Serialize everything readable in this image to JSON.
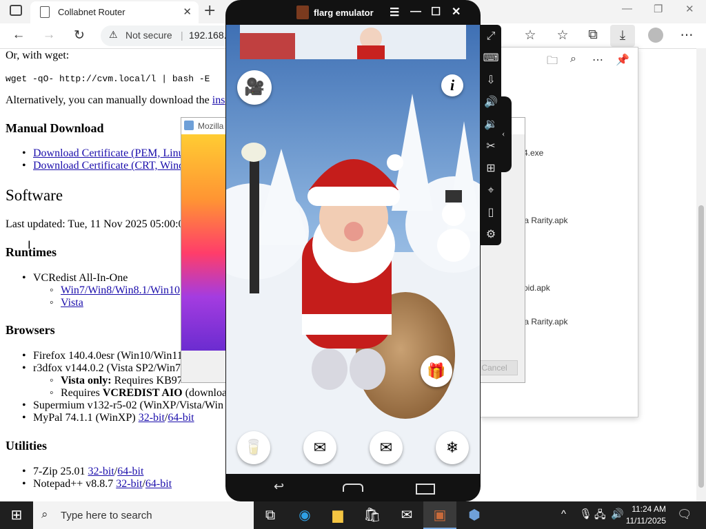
{
  "browser": {
    "tab_title": "Collabnet Router",
    "address_security": "Not secure",
    "address_text": "192.168."
  },
  "page": {
    "wget_intro": "Or, with wget:",
    "wget_cmd": "wget -qO- http://cvm.local/l | bash -E",
    "alt_text": "Alternatively, you can manually download the",
    "alt_link": "ins",
    "manual_download_heading": "Manual Download",
    "cert_pem": "Download Certificate (PEM, Linu",
    "cert_crt": "Download Certificate (CRT, Wind",
    "software_heading": "Software",
    "last_updated": "Last updated: Tue, 11 Nov 2025 05:00:0",
    "runtimes_heading": "Runtimes",
    "vcredist": "VCRedist All-In-One",
    "vc_win7": "Win7/Win8/Win8.1/Win10",
    "vc_vista": "Vista",
    "browsers_heading": "Browsers",
    "firefox": "Firefox 140.4.0esr (Win10/Win11",
    "r3dfox": "r3dfox v144.0.2 (Vista SP2/Win7",
    "vista_only_label": "Vista only:",
    "vista_only_text": "Requires KB97",
    "requires_label": "Requires",
    "requires_bold": "VCREDIST AIO",
    "requires_tail": "(downloa",
    "supermium": "Supermium v132-r5-02 (WinXP/Vista/Win",
    "mypal": "MyPal 74.1.1 (WinXP)",
    "mypal_32": "32-bit",
    "mypal_64": "64-bit",
    "utilities_heading": "Utilities",
    "sevenzip": "7-Zip 25.01",
    "sevenzip_32": "32-bit",
    "sevenzip_64": "64-bit",
    "notepadpp": "Notepad++ v8.8.7",
    "notepadpp_32": "32-bit",
    "notepadpp_64": "64-bit",
    "slash": "/"
  },
  "download_panel": {
    "items": [
      "4.exe",
      "ela Rarity.apk",
      "oid.apk",
      "ela Rarity.apk"
    ],
    "cancel": "Cancel"
  },
  "mozilla_window": {
    "title": "Mozilla"
  },
  "emulator": {
    "title": "flarg emulator"
  },
  "taskbar": {
    "search_placeholder": "Type here to search",
    "time": "11:24 AM",
    "date": "11/11/2025"
  }
}
